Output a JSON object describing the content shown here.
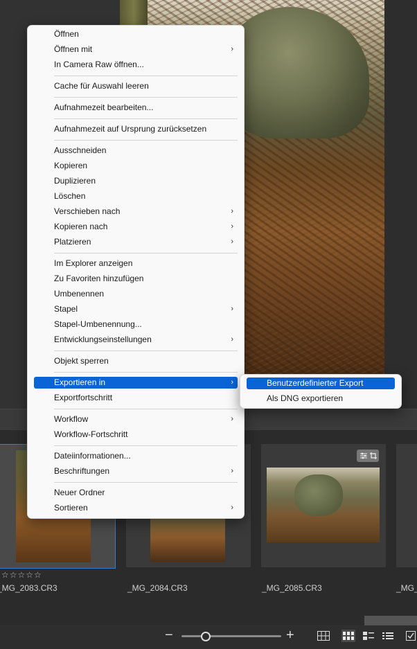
{
  "context_menu": {
    "items": [
      {
        "label": "Öffnen"
      },
      {
        "label": "Öffnen mit"
      },
      {
        "label": "In Camera Raw öffnen..."
      },
      {
        "label": "Cache für Auswahl leeren"
      },
      {
        "label": "Aufnahmezeit bearbeiten..."
      },
      {
        "label": "Aufnahmezeit auf Ursprung zurücksetzen"
      },
      {
        "label": "Ausschneiden"
      },
      {
        "label": "Kopieren"
      },
      {
        "label": "Duplizieren"
      },
      {
        "label": "Löschen"
      },
      {
        "label": "Verschieben nach"
      },
      {
        "label": "Kopieren nach"
      },
      {
        "label": "Platzieren"
      },
      {
        "label": "Im Explorer anzeigen"
      },
      {
        "label": "Zu Favoriten hinzufügen"
      },
      {
        "label": "Umbenennen"
      },
      {
        "label": "Stapel"
      },
      {
        "label": "Stapel-Umbenennung..."
      },
      {
        "label": "Entwicklungseinstellungen"
      },
      {
        "label": "Objekt sperren"
      },
      {
        "label": "Exportieren in"
      },
      {
        "label": "Exportfortschritt"
      },
      {
        "label": "Workflow"
      },
      {
        "label": "Workflow-Fortschritt"
      },
      {
        "label": "Dateiinformationen..."
      },
      {
        "label": "Beschriftungen"
      },
      {
        "label": "Neuer Ordner"
      },
      {
        "label": "Sortieren"
      }
    ],
    "submenu_arrow": "›"
  },
  "submenu": {
    "items": [
      {
        "label": "Benutzerdefinierter Export"
      },
      {
        "label": "Als DNG exportieren"
      }
    ]
  },
  "filmstrip": {
    "items": [
      {
        "filename": "_MG_2083.CR3",
        "rating": "☆☆☆☆☆",
        "selected": true
      },
      {
        "filename": "_MG_2084.CR3"
      },
      {
        "filename": "_MG_2085.CR3"
      },
      {
        "filename": "_MG_"
      }
    ]
  },
  "icons": {
    "submenu": "chevron-right-icon",
    "badge": "adjustments-crop-badge-icon",
    "zoom_out": "minus-icon",
    "zoom_in": "plus-icon",
    "views": [
      "grid-view-icon",
      "thumbnails-view-icon",
      "details-view-icon",
      "list-view-icon",
      "checkbox-icon"
    ]
  },
  "zoom": {
    "minus": "−",
    "plus": "+",
    "level": 0.2
  },
  "colors": {
    "highlight": "#0a64d6",
    "selection_border": "#2f7fd6"
  }
}
